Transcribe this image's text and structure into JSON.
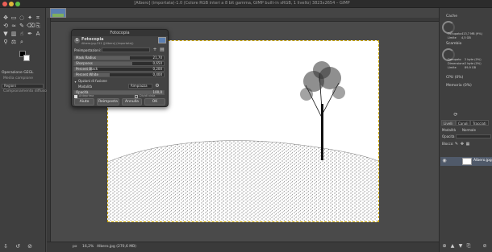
{
  "window": {
    "title": "[Albero] (importata)-1.0 (Colore RGB interi a 8 bit gamma, GIMP built-in sRGB, 1 livello) 3823x2654 – GIMP"
  },
  "left_dock": {
    "tool_options_title": "Operazione GEGL",
    "checkbox_label": "Media campione",
    "preset_label": "Regioni",
    "preset_sub": "Campionamento diffuso"
  },
  "dialog": {
    "title": "Fotocopia",
    "heading": "Fotocopia",
    "subheading": "Albero.jpg-311 ([Albero] (importata))",
    "presets_label": "Preimpostazioni:",
    "sliders": [
      {
        "label": "Mask Radius",
        "value": "21,70",
        "fraction": 0.62
      },
      {
        "label": "Sharpness",
        "value": "0,650",
        "fraction": 0.65
      },
      {
        "label": "Percent Black",
        "value": "0,200",
        "fraction": 0.2
      },
      {
        "label": "Percent White",
        "value": "0,400",
        "fraction": 0.4
      }
    ],
    "blend_section": "Opzioni di fusione",
    "mode_label": "Modalità",
    "mode_value": "Rimpiazza",
    "opacity_label": "Opacità",
    "opacity_value": "100,0",
    "preview_label": "Anteprima",
    "split_label": "Dividi vista",
    "buttons": {
      "help": "Aiuto",
      "reset": "Reimposta",
      "cancel": "Annulla",
      "ok": "OK"
    }
  },
  "status_bar": {
    "unit": "px",
    "zoom": "16,2%",
    "file_info": "Albero.jpg (270,6 MB)"
  },
  "right_dock": {
    "dashboard_title": "Cache",
    "cache_occupato": "Occupato",
    "cache_occupato_value": "413,7 MB (9%)",
    "cache_limite": "Limite",
    "cache_limite_value": "4,5 GB",
    "swap_title": "Scambio",
    "swap_occupato": "Occupato",
    "swap_occupato_value": "2 byte (0%)",
    "swap_dimensione": "Dimensione",
    "swap_dimensione_value": "2 byte (0%)",
    "swap_limite": "Limite",
    "swap_limite_value": "89,9 GB",
    "cpu_label": "CPU (0%)",
    "memory_label": "Memoria (0%)",
    "tabs": [
      "Livelli",
      "Canali",
      "Tracciati"
    ],
    "mode_label": "Modalità",
    "mode_value": "Normale",
    "opacity_label": "Opacità",
    "lock_label": "Blocco:",
    "layer_name": "Albero.jpg"
  },
  "colors": {
    "accent": "#c9a400",
    "selection": "#505a6a"
  }
}
